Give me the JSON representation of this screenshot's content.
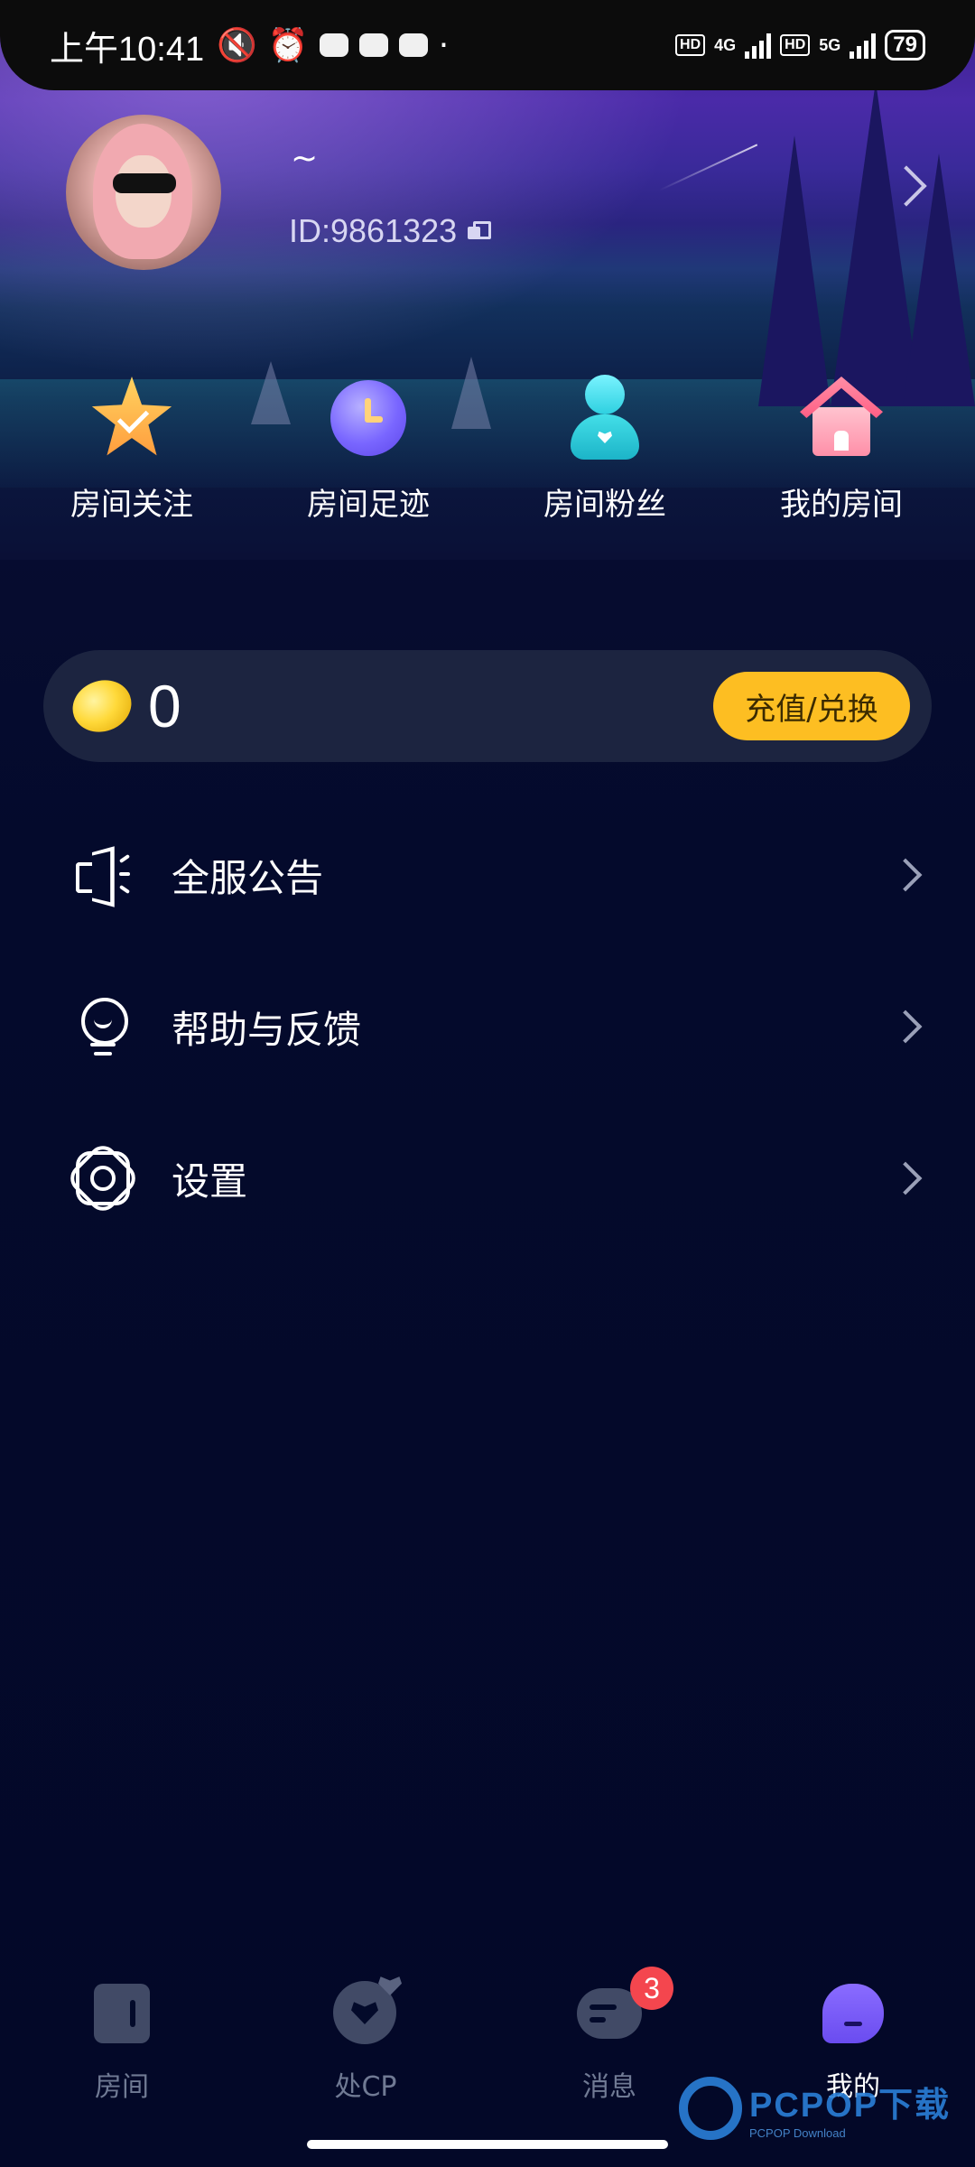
{
  "status_bar": {
    "time": "上午10:41",
    "network_1": "4G",
    "network_2": "5G",
    "hd_label": "HD",
    "battery": "79"
  },
  "profile": {
    "username": "~",
    "user_id": "ID:9861323"
  },
  "quick_actions": [
    {
      "label": "房间关注",
      "icon": "star-icon"
    },
    {
      "label": "房间足迹",
      "icon": "clock-icon"
    },
    {
      "label": "房间粉丝",
      "icon": "person-icon"
    },
    {
      "label": "我的房间",
      "icon": "house-icon"
    }
  ],
  "wallet": {
    "balance": "0",
    "recharge_label": "充值/兑换"
  },
  "menu": [
    {
      "label": "全服公告",
      "icon": "speaker-icon"
    },
    {
      "label": "帮助与反馈",
      "icon": "bulb-icon"
    },
    {
      "label": "设置",
      "icon": "gear-icon"
    }
  ],
  "bottom_nav": [
    {
      "label": "房间",
      "icon": "room-icon"
    },
    {
      "label": "处CP",
      "icon": "cp-heart-icon"
    },
    {
      "label": "消息",
      "icon": "message-icon",
      "badge": "3"
    },
    {
      "label": "我的",
      "icon": "profile-icon",
      "active": true
    }
  ],
  "watermark": {
    "main": "PCPOP下载",
    "sub": "PCPOP Download"
  },
  "colors": {
    "accent_button": "#fdbe22",
    "background": "#030a2a",
    "badge": "#f4464e"
  }
}
